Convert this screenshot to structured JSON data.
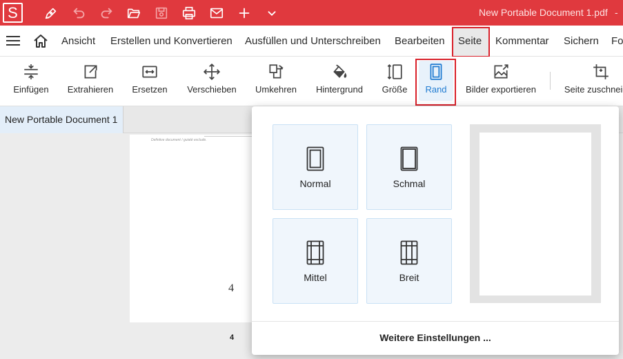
{
  "titlebar": {
    "logo": "S",
    "doc_title": "New Portable Document 1.pdf",
    "title_sep": "-",
    "icons": [
      "pen-icon",
      "undo-icon",
      "redo-icon",
      "folder-open-icon",
      "save-icon",
      "print-icon",
      "mail-icon",
      "plus-icon",
      "chevron-down-icon"
    ]
  },
  "menu": {
    "items": [
      "Ansicht",
      "Erstellen und Konvertieren",
      "Ausfüllen und Unterschreiben",
      "Bearbeiten",
      "Seite",
      "Kommentar",
      "Sichern",
      "Fo"
    ],
    "active": "Seite"
  },
  "toolbar": {
    "tools": [
      "Einfügen",
      "Extrahieren",
      "Ersetzen",
      "Verschieben",
      "Umkehren",
      "Hintergrund",
      "Größe",
      "Rand",
      "Bilder exportieren",
      "Seite zuschneiden"
    ],
    "active": "Rand"
  },
  "tabs": {
    "document": "New Portable Document 1"
  },
  "page": {
    "heading": "Defintive document / guiaté exclude.",
    "digit": "4",
    "number": "4"
  },
  "margin_panel": {
    "options": [
      "Normal",
      "Schmal",
      "Mittel",
      "Breit"
    ],
    "more_settings": "Weitere Einstellungen ..."
  },
  "colors": {
    "titlebar": "#e0393e",
    "accent": "#1f7bd1",
    "highlight_border": "#d9202a",
    "option_bg": "#f0f6fc"
  }
}
